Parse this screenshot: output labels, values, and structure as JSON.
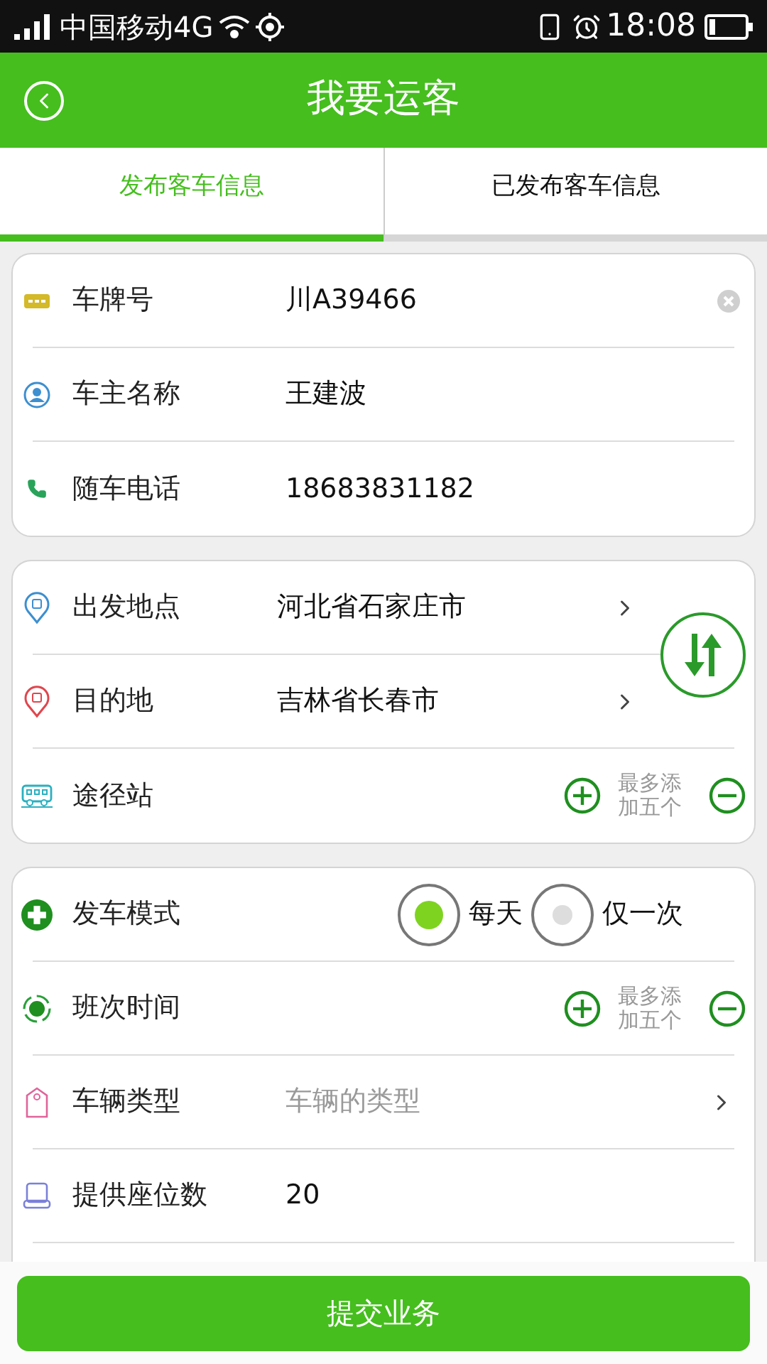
{
  "status_bar": {
    "carrier": "中国移动4G",
    "time": "18:08"
  },
  "header": {
    "title": "我要运客"
  },
  "tabs": [
    {
      "label": "发布客车信息",
      "selected": true
    },
    {
      "label": "已发布客车信息",
      "selected": false
    }
  ],
  "sections": [
    {
      "rows": [
        {
          "kind": "input",
          "label": "车牌号",
          "value": "川A39466",
          "clearable": true
        },
        {
          "kind": "input",
          "label": "车主名称",
          "value": "王建波"
        },
        {
          "kind": "input",
          "label": "随车电话",
          "value": "18683831182"
        }
      ]
    },
    {
      "swap": true,
      "rows": [
        {
          "kind": "select",
          "label": "出发地点",
          "value": "河北省石家庄市"
        },
        {
          "kind": "select",
          "label": "目的地",
          "value": "吉林省长春市"
        },
        {
          "kind": "stepper",
          "label": "途径站",
          "hint": "最多添加五个"
        }
      ]
    },
    {
      "rows": [
        {
          "kind": "radio",
          "label": "发车模式",
          "options": [
            {
              "label": "每天",
              "selected": true
            },
            {
              "label": "仅一次",
              "selected": false
            }
          ]
        },
        {
          "kind": "stepper",
          "label": "班次时间",
          "hint": "最多添加五个"
        },
        {
          "kind": "select",
          "label": "车辆类型",
          "placeholder": "车辆的类型"
        },
        {
          "kind": "input",
          "label": "提供座位数",
          "value": "20"
        },
        {
          "kind": "blank"
        }
      ]
    }
  ],
  "submit": {
    "label": "提交业务"
  }
}
